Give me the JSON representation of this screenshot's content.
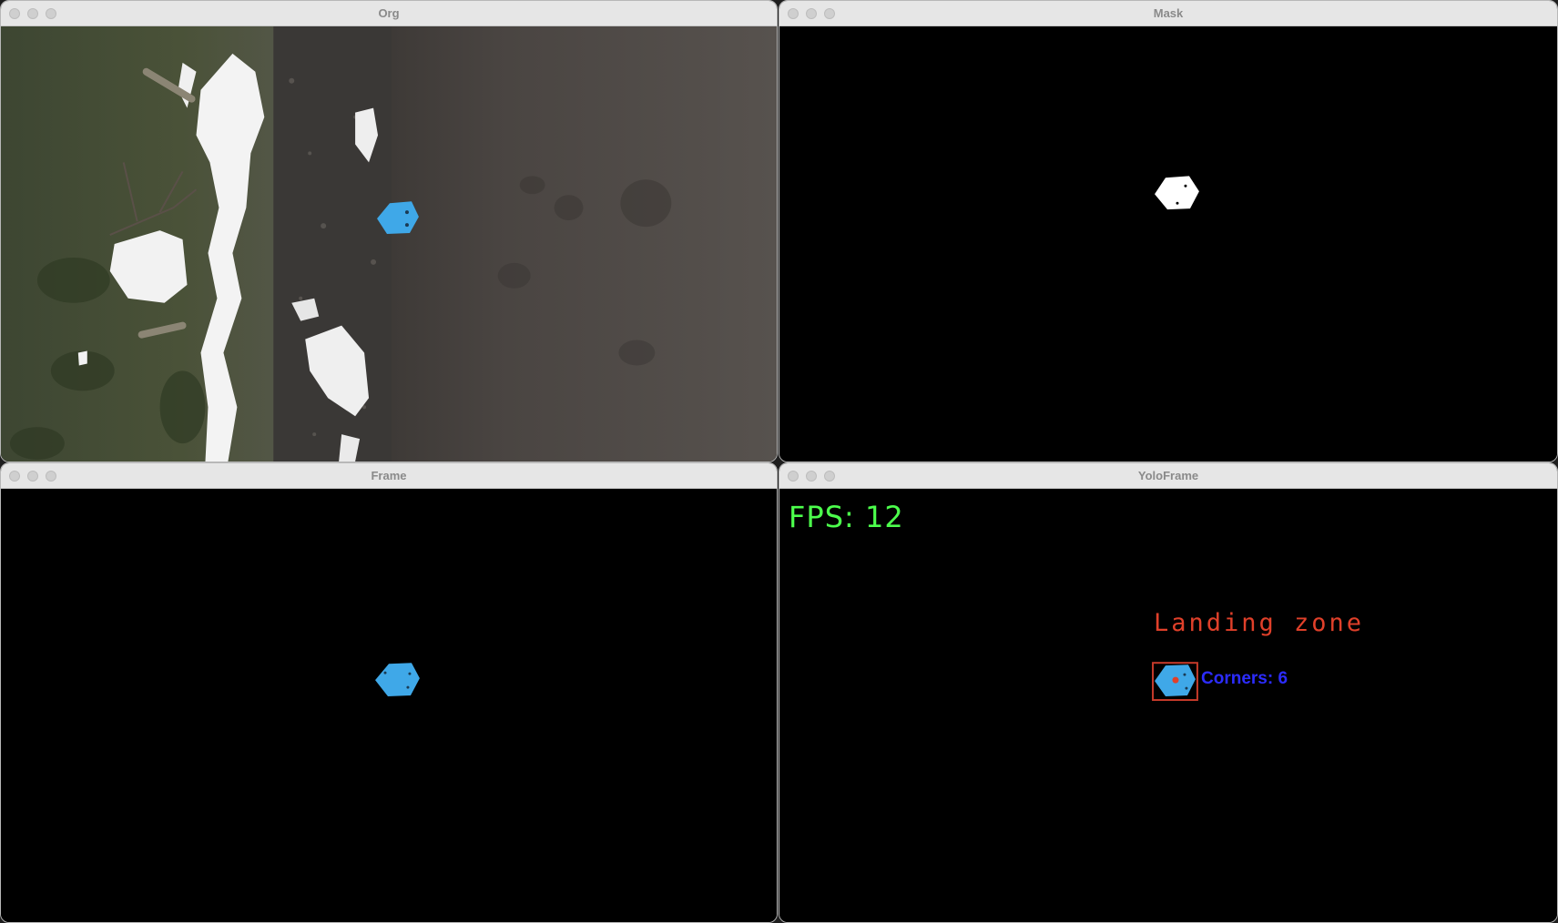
{
  "windows": {
    "org": {
      "title": "Org"
    },
    "mask": {
      "title": "Mask"
    },
    "frame": {
      "title": "Frame"
    },
    "yoloframe": {
      "title": "YoloFrame",
      "fps_text": "FPS: 12",
      "detection_label": "Landing zone",
      "corners_text": "Corners: 6"
    }
  },
  "colors": {
    "marker_blue": "#3fa8e8",
    "fps_green": "#4cff4c",
    "label_red": "#e0402a",
    "corners_blue": "#2c2cff"
  },
  "icons": {
    "close": "close-dot-icon",
    "minimize": "minimize-dot-icon",
    "zoom": "zoom-dot-icon"
  }
}
